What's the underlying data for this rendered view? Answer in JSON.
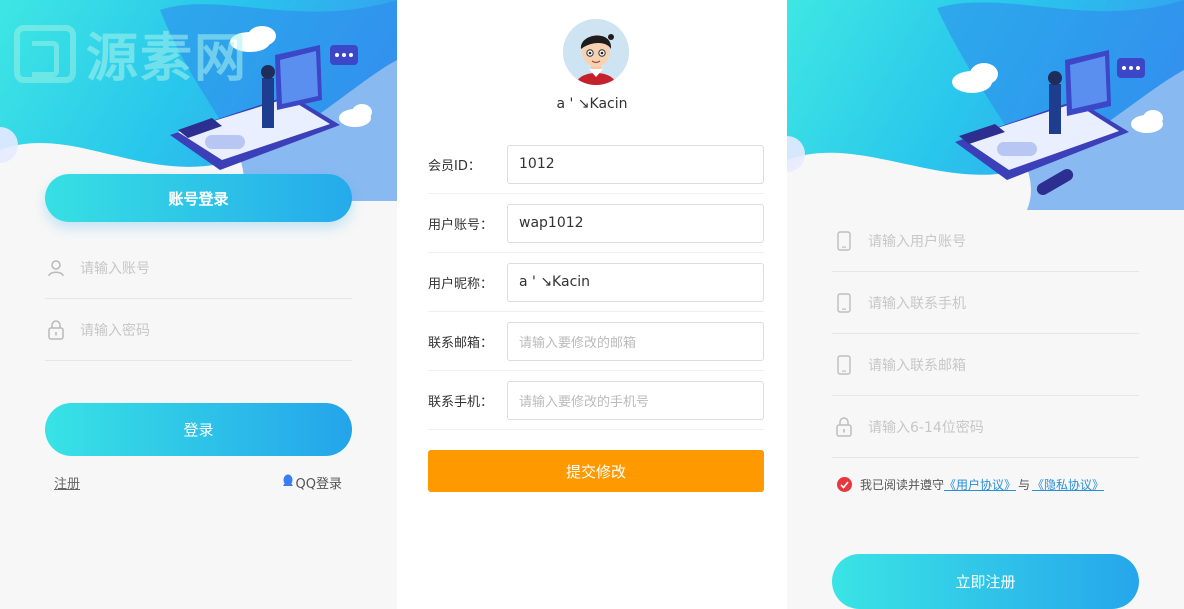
{
  "login_panel": {
    "watermark": "源素网",
    "tab_label": "账号登录",
    "account_placeholder": "请输入账号",
    "password_placeholder": "请输入密码",
    "login_button": "登录",
    "register_link": "注册",
    "qq_login": "QQ登录",
    "icons": [
      "user-icon",
      "lock-icon",
      "qq-icon"
    ]
  },
  "profile_panel": {
    "nickname": "a ' ↘Kacin",
    "fields": [
      {
        "label": "会员ID：",
        "value": "1012",
        "placeholder": ""
      },
      {
        "label": "用户账号：",
        "value": "wap1012",
        "placeholder": ""
      },
      {
        "label": "用户昵称：",
        "value": "a ' ↘Kacin",
        "placeholder": ""
      },
      {
        "label": "联系邮箱：",
        "value": "",
        "placeholder": "请输入要修改的邮箱"
      },
      {
        "label": "联系手机：",
        "value": "",
        "placeholder": "请输入要修改的手机号"
      }
    ],
    "submit_button": "提交修改"
  },
  "register_panel": {
    "username_placeholder": "请输入用户账号",
    "phone_placeholder": "请输入联系手机",
    "email_placeholder": "请输入联系邮箱",
    "password_placeholder": "请输入6-14位密码",
    "agree_prefix": "我已阅读并遵守",
    "user_agreement": "《用户协议》",
    "agree_and": "与",
    "privacy_agreement": "《隐私协议》",
    "register_button": "立即注册",
    "icons": [
      "phone-icon",
      "lock-icon",
      "check-icon"
    ]
  },
  "colors": {
    "accent_gradient_start": "#38e3e5",
    "accent_gradient_end": "#24a4eb",
    "submit_orange": "#ff9900",
    "link_blue": "#2a8fd8",
    "check_red": "#e8383d"
  }
}
